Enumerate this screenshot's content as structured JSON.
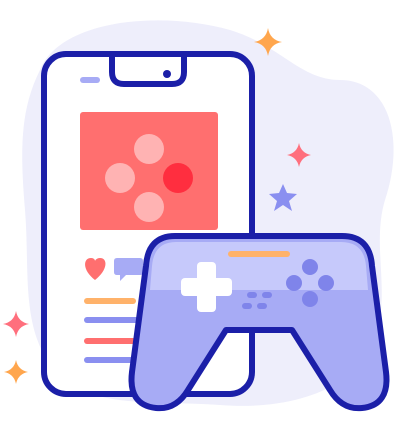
{
  "illustration": {
    "subject": "mobile-gaming",
    "icons": [
      "smartphone-icon",
      "gamepad-icon",
      "sparkle-icon",
      "star-icon",
      "heart-icon",
      "chat-bubble-icon"
    ]
  },
  "colors": {
    "outline": "#1b1fa8",
    "blob": "#eeeefb",
    "phone_body": "#ffffff",
    "phone_shade": "#dfe0f7",
    "card": "#ff6f6f",
    "card_dots": "#ffb3b3",
    "card_dot_active": "#ff2e3f",
    "heart": "#ff6f6f",
    "bubble": "#a7abf5",
    "line_orange": "#ffb26a",
    "line_blue": "#8a8ff0",
    "line_red": "#ff6f6f",
    "pad_body": "#a7abf5",
    "pad_top": "#c6c9fb",
    "pad_accent": "#ffb26a",
    "pad_dark": "#7f84ea",
    "pad_cross": "#ffffff",
    "sparkle_orange": "#ffa64d",
    "sparkle_red": "#ff6f7d",
    "star_blue": "#8a8ff0"
  }
}
